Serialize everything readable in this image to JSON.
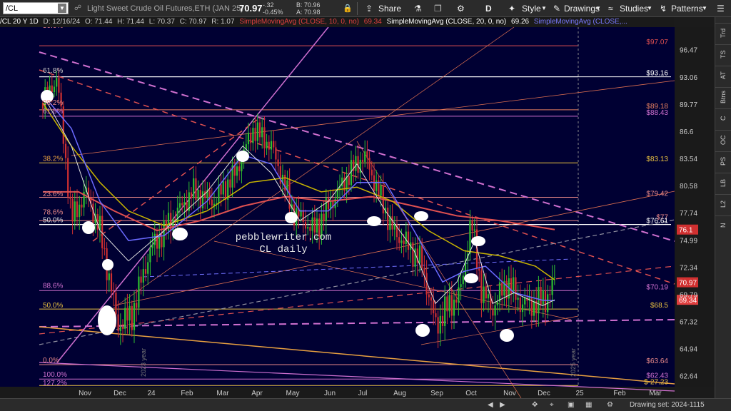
{
  "toolbar": {
    "symbol": "/CL",
    "description": "Light Sweet Crude Oil Futures,ETH (JAN 25)",
    "last_price": "70.97",
    "change": "-.32",
    "change_pct": "-0.45%",
    "bid": "B: 70.96",
    "ask": "A: 70.98",
    "share_label": "Share",
    "period_label": "D",
    "style_label": "Style",
    "drawings_label": "Drawings",
    "studies_label": "Studies",
    "patterns_label": "Patterns"
  },
  "infobar": {
    "ticker_period": "/CL 20 Y 1D",
    "date": "D: 12/16/24",
    "open": "O: 71.44",
    "high": "H: 71.44",
    "low": "L: 70.37",
    "close": "C: 70.97",
    "range": "R: 1.07",
    "sma10": "SimpleMovingAvg (CLOSE, 10, 0, no)",
    "sma10_value": "69.34",
    "sma20": "SimpleMovingAvg (CLOSE, 20, 0, no)",
    "sma20_value": "69.26",
    "sma50": "SimpleMovingAvg (CLOSE,..."
  },
  "right_nav": [
    "Trd",
    "TS",
    "AT",
    "Btns",
    "C",
    "OC",
    "PS",
    "LB",
    "L2",
    "N"
  ],
  "bottom": {
    "drawing_set": "Drawing set: 2024-1115"
  },
  "chart_data": {
    "type": "candlestick",
    "x_tick_labels": [
      "Nov",
      "Dec",
      "24",
      "Feb",
      "Mar",
      "Apr",
      "May",
      "Jun",
      "Jul",
      "Aug",
      "Sep",
      "Oct",
      "Nov",
      "Dec",
      "25",
      "Feb",
      "Mar"
    ],
    "y_tick_labels": [
      "96.47",
      "93.06",
      "89.77",
      "86.6",
      "83.54",
      "80.58",
      "77.74",
      "74.99",
      "72.34",
      "69.79",
      "67.32",
      "64.94",
      "62.64"
    ],
    "ylim": [
      61.8,
      99.5
    ],
    "log_scale": true,
    "annotation_text": [
      "pebblewriter.com",
      "CL daily"
    ],
    "vertical_labels": [
      "2023 year",
      "2025 year"
    ],
    "fib_labels_left": [
      {
        "text": "50.0%",
        "y": 99.2,
        "color": "#e88888"
      },
      {
        "text": "61.8%",
        "y": 93.5,
        "color": "#cccccc"
      },
      {
        "text": "38.2%",
        "y": 89.6,
        "color": "#e88888"
      },
      {
        "text": "61.8%",
        "y": 88.6,
        "color": "#d070d0"
      },
      {
        "text": "38.2%",
        "y": 83.2,
        "color": "#e8a040"
      },
      {
        "text": "23.6%",
        "y": 79.4,
        "color": "#e88888"
      },
      {
        "text": "78.6%",
        "y": 77.5,
        "color": "#e88888"
      },
      {
        "text": "50.0%",
        "y": 76.7,
        "color": "#dddddd"
      },
      {
        "text": "88.6%",
        "y": 70.3,
        "color": "#d070d0"
      },
      {
        "text": "50.0%",
        "y": 68.5,
        "color": "#e8c040"
      },
      {
        "text": "0.0%",
        "y": 63.7,
        "color": "#e88888"
      },
      {
        "text": "100.0%",
        "y": 62.5,
        "color": "#d070d0"
      },
      {
        "text": "127.2%",
        "y": 61.8,
        "color": "#d070d0"
      }
    ],
    "level_labels_right": [
      {
        "text": "$97.07",
        "y": 97.07,
        "color": "#e05050"
      },
      {
        "text": "$93.16",
        "y": 93.16,
        "color": "#ffffff"
      },
      {
        "text": "$89.18",
        "y": 89.18,
        "color": "#e88060"
      },
      {
        "text": "$88.43",
        "y": 88.43,
        "color": "#d070d0"
      },
      {
        "text": "$83.13",
        "y": 83.13,
        "color": "#e8c040"
      },
      {
        "text": "$79.42",
        "y": 79.42,
        "color": "#e88888"
      },
      {
        "text": "$77",
        "y": 77.0,
        "color": "#e88888"
      },
      {
        "text": "$76.61",
        "y": 76.61,
        "color": "#ffffff"
      },
      {
        "text": "$70.19",
        "y": 70.19,
        "color": "#d070d0"
      },
      {
        "text": "$68.5",
        "y": 68.5,
        "color": "#e8c040"
      },
      {
        "text": "$63.64",
        "y": 63.64,
        "color": "#e88888"
      },
      {
        "text": "$62.43",
        "y": 62.43,
        "color": "#d070d0"
      },
      {
        "text": "$-27.23",
        "y": 61.9,
        "color": "#e8c040"
      }
    ],
    "price_boxes": [
      {
        "text": "76.1",
        "y": 76.1,
        "color": "#d03030"
      },
      {
        "text": "70.97",
        "y": 70.97,
        "color": "#d03030"
      },
      {
        "text": "69.34",
        "y": 69.34,
        "color": "#e04040"
      }
    ],
    "colors": {
      "background": "#000033",
      "up": "#2fbf2f",
      "down": "#d03030",
      "sma10": "#e0e0e0",
      "sma20": "#6a6aff",
      "sma50": "#c8b400",
      "sma200": "#e05050"
    }
  }
}
